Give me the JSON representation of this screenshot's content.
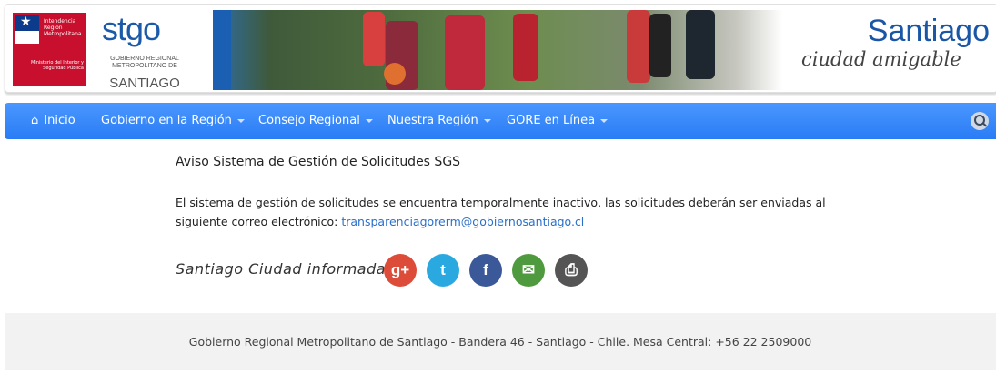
{
  "header": {
    "gov_logo_text_top": "Intendencia Región Metropolitana",
    "gov_logo_text_bottom": "Ministerio del Interior y Seguridad Pública",
    "stgo_word": "stgo",
    "stgo_subtitle": "GOBIERNO REGIONAL METROPOLITANO DE",
    "stgo_big": "SANTIAGO",
    "brand_title": "Santiago",
    "brand_subtitle": "ciudad amigable"
  },
  "nav": {
    "items": [
      {
        "label": "Inicio",
        "dropdown": false
      },
      {
        "label": "Gobierno en la Región",
        "dropdown": true
      },
      {
        "label": "Consejo Regional",
        "dropdown": true
      },
      {
        "label": "Nuestra Región",
        "dropdown": true
      },
      {
        "label": "GORE en Línea",
        "dropdown": true
      }
    ]
  },
  "main": {
    "title": "Aviso Sistema de Gestión de Solicitudes SGS",
    "para_text": "El sistema de gestión de solicitudes se encuentra temporalmente inactivo, las solicitudes deberán ser enviadas al siguiente correo electrónico: ",
    "email": "transparenciagorerm@gobiernosantiago.cl"
  },
  "share": {
    "label": "Santiago Ciudad informada",
    "buttons": [
      {
        "name": "google-plus",
        "glyph": "g+",
        "color": "#dd4b39"
      },
      {
        "name": "twitter",
        "glyph": "t",
        "color": "#2aa9e0"
      },
      {
        "name": "facebook",
        "glyph": "f",
        "color": "#3b5998"
      },
      {
        "name": "email",
        "glyph": "✉",
        "color": "#4f9a3e"
      },
      {
        "name": "print",
        "glyph": "⎙",
        "color": "#555555"
      }
    ]
  },
  "footer": {
    "text": "Gobierno Regional Metropolitano de Santiago - Bandera 46 - Santiago - Chile. Mesa Central: +56 22 2509000"
  },
  "colors": {
    "nav_blue": "#2a7cf5",
    "link_blue": "#2a6fc9",
    "footer_bg": "#f2f2f2"
  }
}
